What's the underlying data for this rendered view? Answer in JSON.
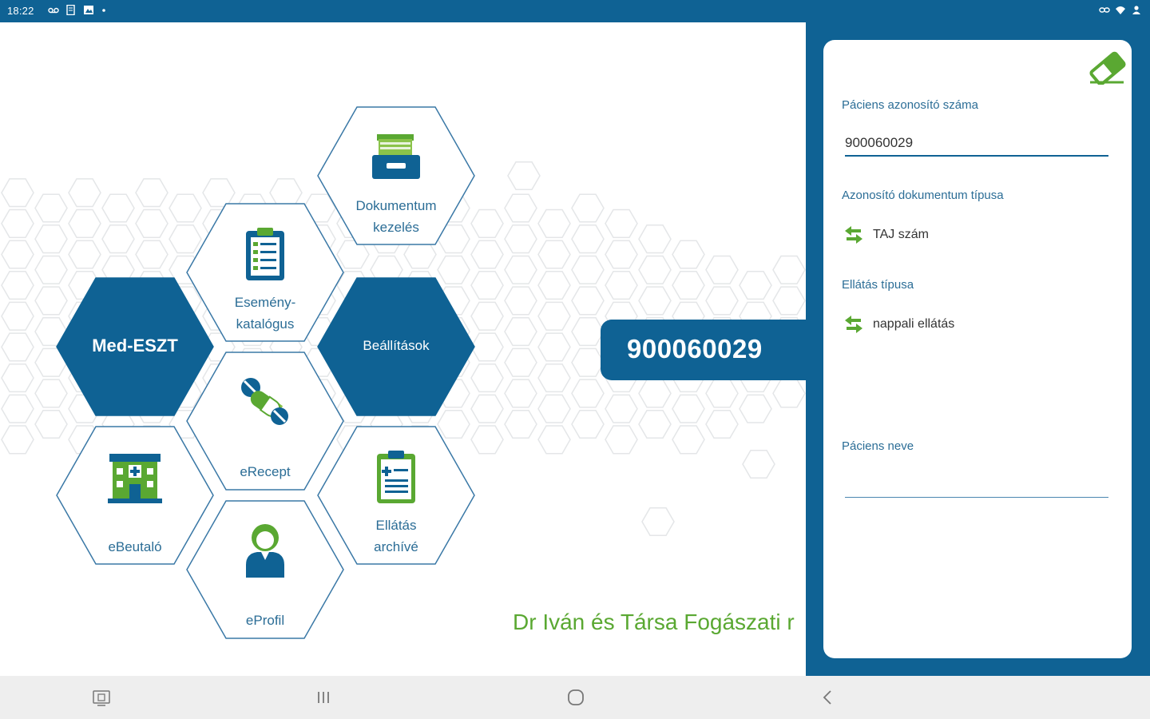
{
  "status_bar": {
    "time": "18:22",
    "left_icons": [
      "voicemail-icon",
      "document-icon",
      "image-icon",
      "dot-icon"
    ],
    "right_icons": [
      "link-icon",
      "wifi-icon",
      "account-icon"
    ]
  },
  "menu": {
    "items": [
      {
        "id": "dokumentum",
        "label_line1": "Dokumentum",
        "label_line2": "kezelés",
        "icon": "file-tray-icon"
      },
      {
        "id": "esemeny",
        "label_line1": "Esemény-",
        "label_line2": "katalógus",
        "icon": "clipboard-checklist-icon"
      },
      {
        "id": "med-eszt",
        "label": "Med-ESZT"
      },
      {
        "id": "beallitasok",
        "label": "Beállítások"
      },
      {
        "id": "erecept",
        "label": "eRecept",
        "icon": "pills-icon"
      },
      {
        "id": "ebeutalo",
        "label": "eBeutaló",
        "icon": "hospital-icon"
      },
      {
        "id": "ellatas-archiv",
        "label_line1": "Ellátás",
        "label_line2": "archívé",
        "icon": "medical-clipboard-icon"
      },
      {
        "id": "eprofil",
        "label": "eProfil",
        "icon": "user-profile-icon"
      }
    ]
  },
  "patient_id_badge": "900060029",
  "clinic_name": "Dr Iván és Társa Fogászati r",
  "form": {
    "clear_icon": "eraser-icon",
    "patient_id_label": "Páciens azonosító száma",
    "patient_id_value": "900060029",
    "doc_type_label": "Azonosító dokumentum típusa",
    "doc_type_value": "TAJ szám",
    "care_type_label": "Ellátás típusa",
    "care_type_value": "nappali ellátás",
    "patient_name_label": "Páciens neve",
    "patient_name_value": "",
    "swap_icon": "swap-arrows-icon"
  },
  "nav_bar": {
    "buttons": [
      "screenshot-icon",
      "recents-icon",
      "home-icon",
      "back-icon"
    ]
  },
  "colors": {
    "primary": "#0f6294",
    "accent_green": "#5aa832",
    "hex_outline": "#3a78a6",
    "background": "#ffffff",
    "nav_background": "#eeeeee"
  }
}
